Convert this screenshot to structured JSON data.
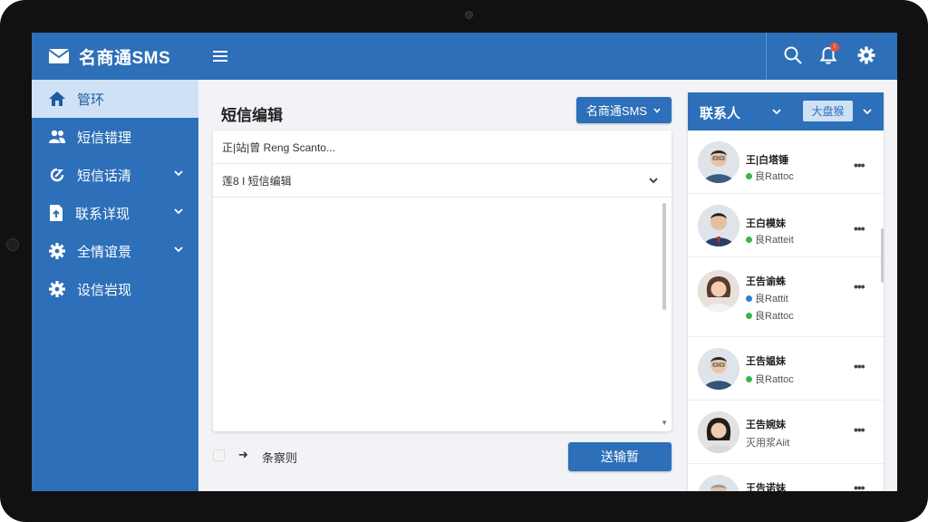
{
  "app": {
    "name": "名商通SMS"
  },
  "sidebar": {
    "items": [
      {
        "label": "管环",
        "icon": "home-icon",
        "active": true,
        "has_submenu": false
      },
      {
        "label": "短信错理",
        "icon": "users-icon",
        "active": false,
        "has_submenu": false
      },
      {
        "label": "短信话清",
        "icon": "refresh-icon",
        "active": false,
        "has_submenu": true
      },
      {
        "label": "联系详现",
        "icon": "upload-icon",
        "active": false,
        "has_submenu": true
      },
      {
        "label": "全情谊景",
        "icon": "gear-icon",
        "active": false,
        "has_submenu": true
      },
      {
        "label": "设信岩现",
        "icon": "gear-icon",
        "active": false,
        "has_submenu": false
      }
    ]
  },
  "topbar": {
    "icons": [
      "menu-icon",
      "search-icon",
      "bell-icon",
      "settings-icon"
    ],
    "notification_badge": "!"
  },
  "editor": {
    "title": "短信编辑",
    "sender_select": "名商通SMS",
    "recipient_field": "正|站|曾 Reng Scanto...",
    "template_field": "莲8 I 短信编辑",
    "body": ""
  },
  "footer": {
    "option_label": "条察则",
    "send_button": "送输暂"
  },
  "contacts": {
    "title": "联系人",
    "filter_button": "大盘猴",
    "items": [
      {
        "name": "王|白塔锤",
        "statuses": [
          {
            "text": "良Rattoc",
            "color": "#3bb54a"
          }
        ],
        "avatar": "avatar-man-glasses"
      },
      {
        "name": "王白模妹",
        "statuses": [
          {
            "text": "良Ratteit",
            "color": "#3bb54a"
          }
        ],
        "avatar": "avatar-man-suit"
      },
      {
        "name": "王告谕蛛",
        "statuses": [
          {
            "text": "良Rattit",
            "color": "#2f7fd0"
          },
          {
            "text": "良Rattoc",
            "color": "#3bb54a"
          }
        ],
        "avatar": "avatar-woman"
      },
      {
        "name": "王告媪妹",
        "statuses": [
          {
            "text": "良Rattoc",
            "color": "#3bb54a"
          }
        ],
        "avatar": "avatar-man-young"
      },
      {
        "name": "王告婉妹",
        "statuses": [
          {
            "text": "灭用浆Aiit",
            "color": ""
          }
        ],
        "avatar": "avatar-woman-dark"
      },
      {
        "name": "王告诺妹",
        "statuses": [],
        "avatar": "avatar-man-older"
      }
    ]
  },
  "colors": {
    "primary": "#2d6fb8",
    "active_nav_bg": "#cfe1f5",
    "online": "#3bb54a",
    "away": "#2f7fd0",
    "badge": "#e5533c"
  }
}
